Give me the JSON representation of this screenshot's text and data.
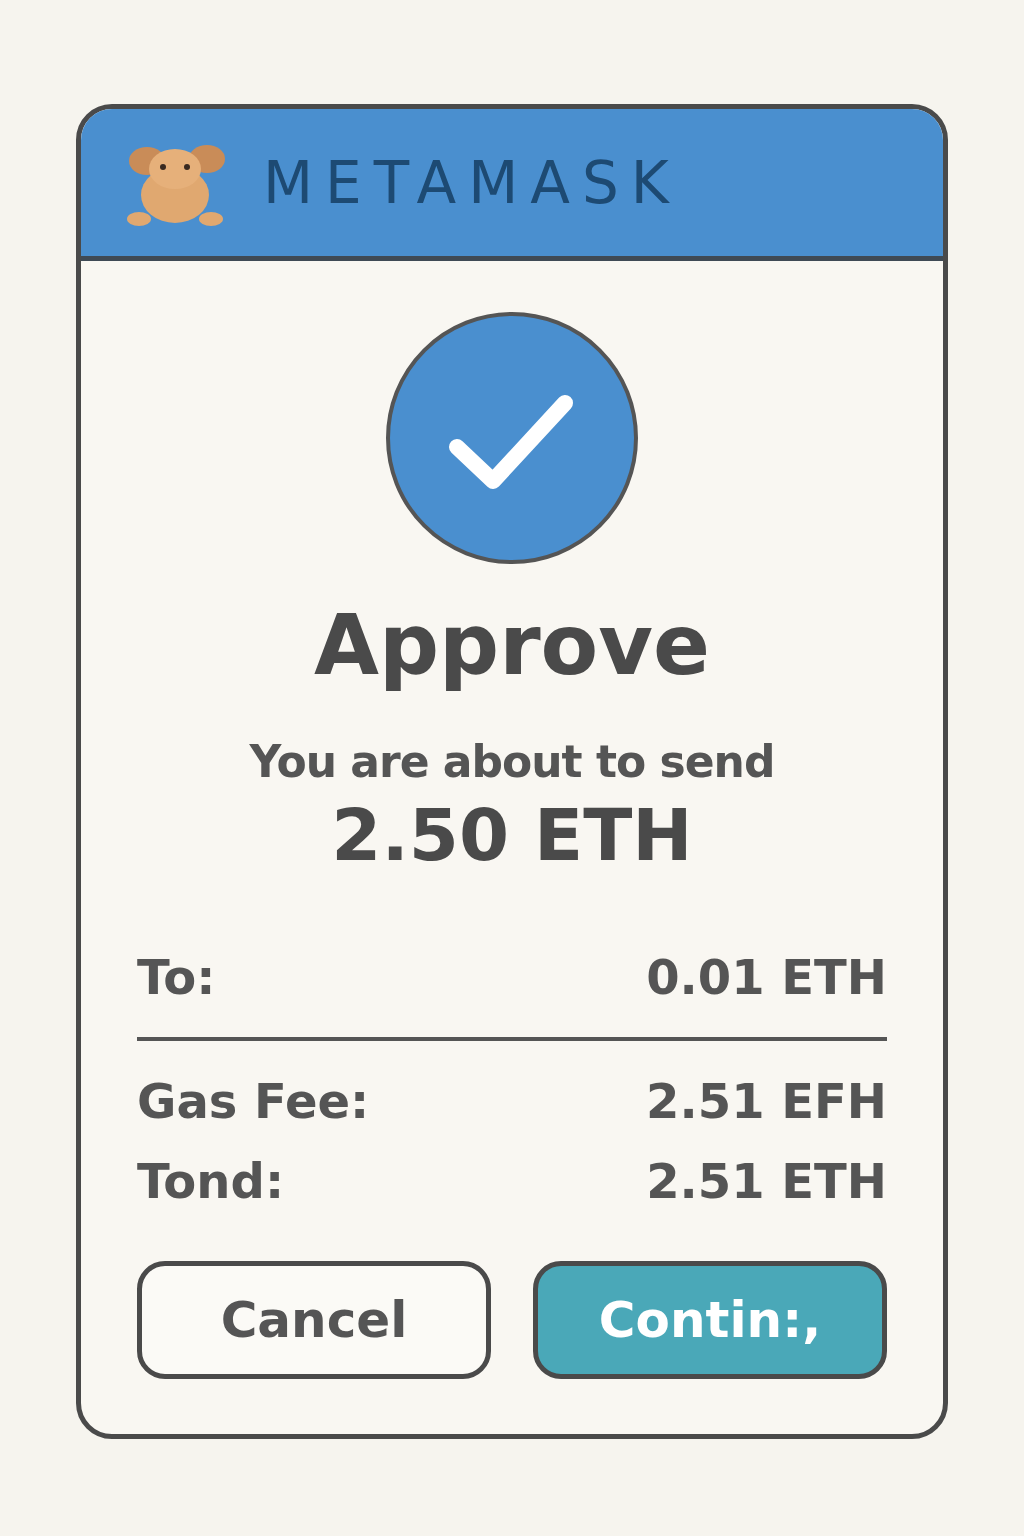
{
  "header": {
    "brand": "METAMASK"
  },
  "status": {
    "kind": "success"
  },
  "title": "Approve",
  "subtitle": "You are about to send",
  "amount": "2.50 ETH",
  "summary_row": {
    "label": "To:",
    "value": "0.01 ETH"
  },
  "fee_rows": [
    {
      "label": "Gas Fee:",
      "value": "2.51 EFH"
    },
    {
      "label": "Tond:",
      "value": "2.51 ETH"
    }
  ],
  "buttons": [
    {
      "label": "Cancel",
      "kind": "secondary"
    },
    {
      "label": "Contin:,",
      "kind": "primary"
    }
  ]
}
